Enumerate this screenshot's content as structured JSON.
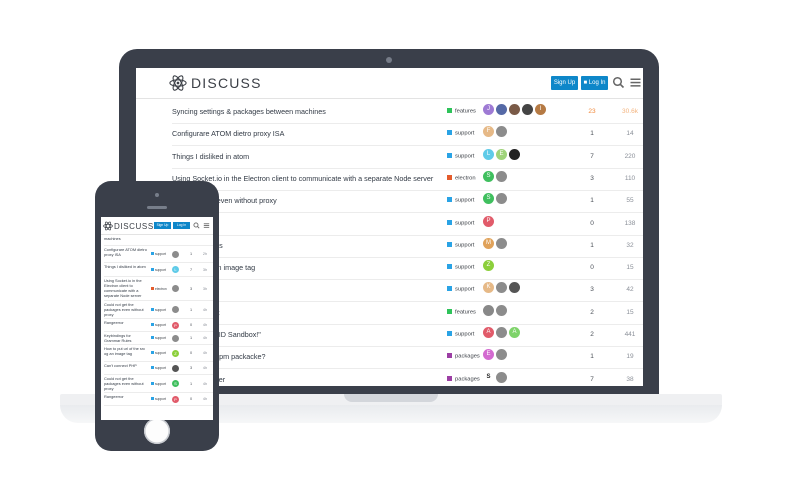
{
  "site": {
    "logo_text": "DISCUSS",
    "signup_label": "Sign Up",
    "login_label": "Log In",
    "brand_color": "#0e87c9"
  },
  "categories": {
    "features": {
      "label": "features",
      "color": "#2ec35a"
    },
    "support": {
      "label": "support",
      "color": "#2aa3e5"
    },
    "electron": {
      "label": "electron",
      "color": "#e45b2c"
    },
    "packages": {
      "label": "packages",
      "color": "#9c3ea4"
    }
  },
  "topics": [
    {
      "title": "Syncing settings & packages between machines",
      "category": "features",
      "avatars": [
        {
          "l": "J",
          "c": "#9e7ad4"
        },
        {
          "l": "",
          "c": "#5569a6"
        },
        {
          "l": "",
          "c": "#7a5a47"
        },
        {
          "l": "",
          "c": "#444"
        },
        {
          "l": "I",
          "c": "#b57a44"
        }
      ],
      "replies": "23",
      "views": "30.6k",
      "activity": "38m",
      "hot": true
    },
    {
      "title": "Configurare ATOM dietro proxy ISA",
      "category": "support",
      "avatars": [
        {
          "l": "F",
          "c": "#e6b987"
        },
        {
          "l": "",
          "c": "#8c8c8c"
        }
      ],
      "replies": "1",
      "views": "14",
      "activity": "2h"
    },
    {
      "title": "Things I disliked in atom",
      "category": "support",
      "avatars": [
        {
          "l": "L",
          "c": "#5fcbe8"
        },
        {
          "l": "E",
          "c": "#9fd37a"
        },
        {
          "l": "",
          "c": "#222"
        }
      ],
      "replies": "7",
      "views": "220",
      "activity": "3h"
    },
    {
      "title": "Using Socket.io in the Electron client to communicate with a separate Node server",
      "category": "electron",
      "avatars": [
        {
          "l": "S",
          "c": "#3fbf5e"
        },
        {
          "l": "",
          "c": "#8c8c8c"
        }
      ],
      "replies": "3",
      "views": "110",
      "activity": "3h"
    },
    {
      "title": "Could not get the packages even without proxy",
      "category": "support",
      "avatars": [
        {
          "l": "S",
          "c": "#3fbf5e"
        },
        {
          "l": "",
          "c": "#8c8c8c"
        }
      ],
      "replies": "1",
      "views": "55",
      "activity": "4h"
    },
    {
      "title": "Rangeerror",
      "category": "support",
      "avatars": [
        {
          "l": "P",
          "c": "#e15b6a"
        }
      ],
      "replies": "0",
      "views": "138",
      "activity": "4h"
    },
    {
      "title": "Keybindings for Grammar Rules",
      "category": "support",
      "avatars": [
        {
          "l": "M",
          "c": "#e0a25a"
        },
        {
          "l": "",
          "c": "#8c8c8c"
        }
      ],
      "replies": "1",
      "views": "32",
      "activity": "4h"
    },
    {
      "title": "How to put url of the src og an image tag",
      "category": "support",
      "avatars": [
        {
          "l": "Z",
          "c": "#8ccf3b"
        }
      ],
      "replies": "0",
      "views": "15",
      "activity": "4h"
    },
    {
      "title": "Can't connect PHP",
      "category": "support",
      "avatars": [
        {
          "l": "K",
          "c": "#e6b987"
        },
        {
          "l": "",
          "c": "#8c8c8c"
        },
        {
          "l": "",
          "c": "#555"
        }
      ],
      "replies": "3",
      "views": "42",
      "activity": "4h"
    },
    {
      "title": "Variable Highlight",
      "category": "features",
      "avatars": [
        {
          "l": "",
          "c": "#888"
        },
        {
          "l": "",
          "c": "#8c8c8c"
        }
      ],
      "replies": "2",
      "views": "15",
      "activity": "5h"
    },
    {
      "title": "without the SUID Sandbox!\"",
      "category": "support",
      "avatars": [
        {
          "l": "A",
          "c": "#e15b6a"
        },
        {
          "l": "",
          "c": "#8c8c8c"
        },
        {
          "l": "A",
          "c": "#7ed36a"
        }
      ],
      "replies": "2",
      "views": "441",
      "activity": "6h"
    },
    {
      "title": "version of an apm packacke?",
      "category": "packages",
      "avatars": [
        {
          "l": "E",
          "c": "#d36ad0"
        },
        {
          "l": "",
          "c": "#8c8c8c"
        }
      ],
      "replies": "1",
      "views": "19",
      "activity": "7h"
    },
    {
      "title": "m packagefolder",
      "category": "packages",
      "avatars": [
        {
          "l": "S",
          "c": "#ffffff"
        },
        {
          "l": "",
          "c": "#8c8c8c"
        }
      ],
      "replies": "7",
      "views": "38",
      "activity": "7h"
    }
  ],
  "laptop_titles": [
    "Syncing settings & packages between machines",
    "Configurare ATOM dietro proxy ISA",
    "Things I disliked in atom",
    "Using Socket.io in the Electron client to communicate with a separate Node server",
    "the packages even without proxy",
    "",
    "Grammar Rules",
    "of the src og an image tag",
    "PHP",
    "riable Highlight",
    "without the SUID Sandbox!\"",
    "version of an apm packacke?",
    "m packagefolder"
  ],
  "phone_topics": [
    {
      "title": "machines",
      "cat": "",
      "av": {
        "l": "",
        "c": ""
      },
      "rep": "",
      "act": ""
    },
    {
      "title": "Configurare ATOM dietro proxy ISA",
      "cat": "support",
      "av": {
        "l": "",
        "c": "#8c8c8c"
      },
      "rep": "1",
      "act": "2h"
    },
    {
      "title": "Things I disliked in atom",
      "cat": "support",
      "av": {
        "l": "L",
        "c": "#5fcbe8"
      },
      "rep": "7",
      "act": "3h"
    },
    {
      "title": "Using Socket.io in the Electron client to communicate with a separate Node server",
      "cat": "electron",
      "av": {
        "l": "",
        "c": "#8c8c8c"
      },
      "rep": "3",
      "act": "3h"
    },
    {
      "title": "Could not get the packages even without proxy",
      "cat": "support",
      "av": {
        "l": "",
        "c": "#8c8c8c"
      },
      "rep": "1",
      "act": "4h"
    },
    {
      "title": "Rangeerror",
      "cat": "support",
      "av": {
        "l": "P",
        "c": "#e15b6a"
      },
      "rep": "0",
      "act": "4h"
    },
    {
      "title": "Keybindings for Grammar Rules",
      "cat": "support",
      "av": {
        "l": "",
        "c": "#8c8c8c"
      },
      "rep": "1",
      "act": "4h"
    },
    {
      "title": "How to put url of the src og an image tag",
      "cat": "support",
      "av": {
        "l": "Z",
        "c": "#8ccf3b"
      },
      "rep": "0",
      "act": "4h"
    },
    {
      "title": "Can't connect PHP",
      "cat": "support",
      "av": {
        "l": "",
        "c": "#555"
      },
      "rep": "3",
      "act": "4h"
    },
    {
      "title": "Could not get the packages even without proxy",
      "cat": "support",
      "av": {
        "l": "S",
        "c": "#3fbf5e"
      },
      "rep": "1",
      "act": "4h"
    },
    {
      "title": "Rangeerror",
      "cat": "support",
      "av": {
        "l": "P",
        "c": "#e15b6a"
      },
      "rep": "0",
      "act": "4h"
    }
  ]
}
